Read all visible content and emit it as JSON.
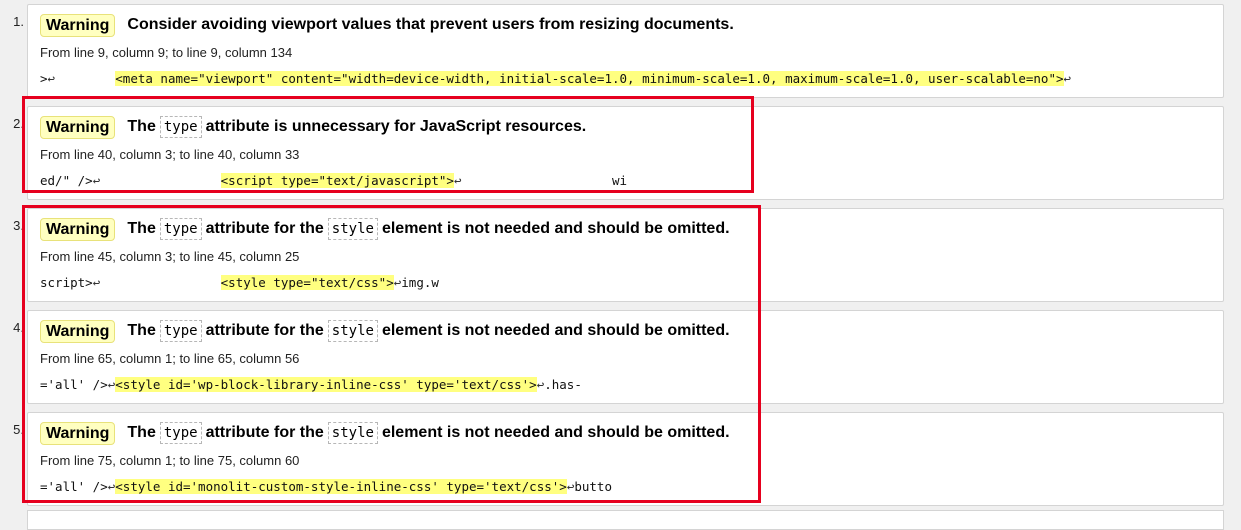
{
  "messages": [
    {
      "number": "1.",
      "badge": "Warning",
      "parts": [
        {
          "t": "Consider avoiding viewport values that prevent users from resizing documents."
        }
      ],
      "location": "From line 9, column 9; to line 9, column 134",
      "extract": [
        {
          "t": ">"
        },
        {
          "lf": "↩"
        },
        {
          "t": "        "
        },
        {
          "h": "<meta name=\"viewport\" content=\"width=device-width, initial-scale=1.0, minimum-scale=1.0, maximum-scale=1.0, user-scalable=no\">"
        },
        {
          "lf": "↩"
        }
      ]
    },
    {
      "number": "2.",
      "badge": "Warning",
      "parts": [
        {
          "t": "The"
        },
        {
          "c": "type"
        },
        {
          "t": "attribute is unnecessary for JavaScript resources."
        }
      ],
      "location": "From line 40, column 3; to line 40, column 33",
      "extract": [
        {
          "t": "ed/\" />"
        },
        {
          "lf": "↩"
        },
        {
          "t": "                "
        },
        {
          "h": "<script type=\"text/javascript\">"
        },
        {
          "lf": "↩"
        },
        {
          "t": "                    wi"
        }
      ]
    },
    {
      "number": "3.",
      "badge": "Warning",
      "parts": [
        {
          "t": "The"
        },
        {
          "c": "type"
        },
        {
          "t": "attribute for the"
        },
        {
          "c": "style"
        },
        {
          "t": "element is not needed and should be omitted."
        }
      ],
      "location": "From line 45, column 3; to line 45, column 25",
      "extract": [
        {
          "t": "script>"
        },
        {
          "lf": "↩"
        },
        {
          "t": "                "
        },
        {
          "h": "<style type=\"text/css\">"
        },
        {
          "lf": "↩"
        },
        {
          "t": "img.w"
        }
      ]
    },
    {
      "number": "4.",
      "badge": "Warning",
      "parts": [
        {
          "t": "The"
        },
        {
          "c": "type"
        },
        {
          "t": "attribute for the"
        },
        {
          "c": "style"
        },
        {
          "t": "element is not needed and should be omitted."
        }
      ],
      "location": "From line 65, column 1; to line 65, column 56",
      "extract": [
        {
          "t": "='all' />"
        },
        {
          "lf": "↩"
        },
        {
          "h": "<style id='wp-block-library-inline-css' type='text/css'>"
        },
        {
          "lf": "↩"
        },
        {
          "t": ".has-"
        }
      ]
    },
    {
      "number": "5.",
      "badge": "Warning",
      "parts": [
        {
          "t": "The"
        },
        {
          "c": "type"
        },
        {
          "t": "attribute for the"
        },
        {
          "c": "style"
        },
        {
          "t": "element is not needed and should be omitted."
        }
      ],
      "location": "From line 75, column 1; to line 75, column 60",
      "extract": [
        {
          "t": "='all' />"
        },
        {
          "lf": "↩"
        },
        {
          "h": "<style id='monolit-custom-style-inline-css' type='text/css'>"
        },
        {
          "lf": "↩"
        },
        {
          "t": "butto"
        }
      ]
    }
  ],
  "colors": {
    "highlight": "#ffff80",
    "badge_bg": "#ffffc0",
    "annotation_red": "#e6001e"
  }
}
